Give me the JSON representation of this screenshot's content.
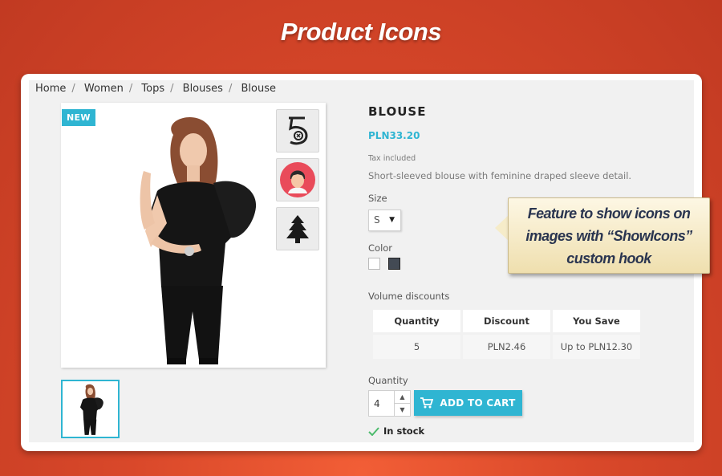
{
  "banner": {
    "title": "Product Icons"
  },
  "breadcrumb": [
    "Home",
    "Women",
    "Tops",
    "Blouses",
    "Blouse"
  ],
  "product": {
    "badge": "NEW",
    "title": "BLOUSE",
    "price": "PLN33.20",
    "tax_note": "Tax included",
    "description": "Short-sleeved blouse with feminine draped sleeve detail.",
    "size_label": "Size",
    "size_value": "S",
    "color_label": "Color",
    "colors": [
      "#ffffff",
      "#434a54"
    ],
    "image_icons": [
      "number-5-icon",
      "face-avatar-icon",
      "tree-icon"
    ]
  },
  "volume_discounts": {
    "label": "Volume discounts",
    "headers": [
      "Quantity",
      "Discount",
      "You Save"
    ],
    "rows": [
      [
        "5",
        "PLN2.46",
        "Up to PLN12.30"
      ]
    ]
  },
  "purchase": {
    "quantity_label": "Quantity",
    "quantity_value": "4",
    "add_to_cart": "ADD TO CART",
    "stock_status": "In stock"
  },
  "callout": {
    "line1": "Feature to show icons on",
    "line2": "images with “ShowIcons”",
    "line3": "custom hook"
  },
  "colors": {
    "accent": "#2fb5d2",
    "background": "#d9482a"
  }
}
